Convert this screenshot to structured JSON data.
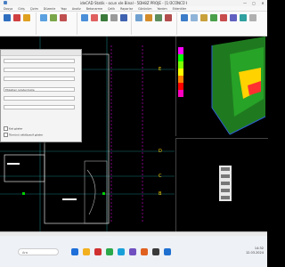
{
  "window": {
    "title": "ideCAD Statik - ocun xle Binal - 5DH8Z PROJE - [1:ÜCÜNCÜ KAT-XAILMA 1-50 KÜTLE]",
    "buttons": [
      "—",
      "▢",
      "✕"
    ]
  },
  "ribbon": {
    "tabs": [
      "Dosya",
      "Giriş",
      "Çizim",
      "Düzenle",
      "Yapı",
      "Analiz",
      "Betonarme",
      "Çelik",
      "Raporlar",
      "Görünüm",
      "Yardım",
      "Eklentiler"
    ]
  },
  "dialog": {
    "fields": [
      "",
      "",
      "",
      "Etiketleri Göster/Gizle",
      "",
      ""
    ],
    "checks": [
      "Kat göster",
      "Tümünü aktif/pasif göster"
    ]
  },
  "drawing": {
    "axis_labels": [
      "E",
      "D",
      "C",
      "B"
    ]
  },
  "legend": {
    "colors": [
      "#ff00ff",
      "#00ff00",
      "#7fff00",
      "#ffff00",
      "#ff8000",
      "#ff0000",
      "#ff00c0"
    ]
  },
  "taskbar": {
    "search_placeholder": "Ara",
    "time": "14:32",
    "date": "12.03.2024"
  }
}
